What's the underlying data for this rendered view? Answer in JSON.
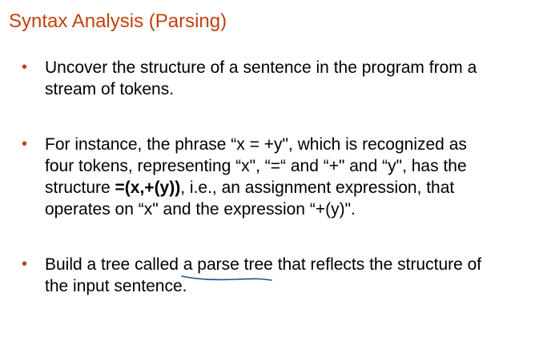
{
  "colors": {
    "title": "#c0420f",
    "bullet": "#c0420f",
    "text": "#000000",
    "ink": "#1f4e9a"
  },
  "title": "Syntax Analysis (Parsing)",
  "bullet_glyph": "•",
  "bullets": [
    {
      "lines": [
        "Uncover the structure of a sentence in the program from a",
        "stream of tokens."
      ]
    },
    {
      "line1": "For instance, the phrase “x = +y\", which is recognized as",
      "line2": "four tokens, representing “x\", “=“ and “+\" and “y\", has the",
      "line3_before": "structure ",
      "line3_bold": "=(x,+(y))",
      "line3_after": ", i.e., an assignment expression, that",
      "line4": "operates on “x\" and the expression “+(y)\"."
    },
    {
      "line1_before": "Build a tree called ",
      "line1_underlined": "a parse tree",
      "line1_after": " that reflects the structure of",
      "line2": "the input sentence."
    }
  ],
  "annotation": {
    "icon": "handwritten-underline-icon"
  }
}
